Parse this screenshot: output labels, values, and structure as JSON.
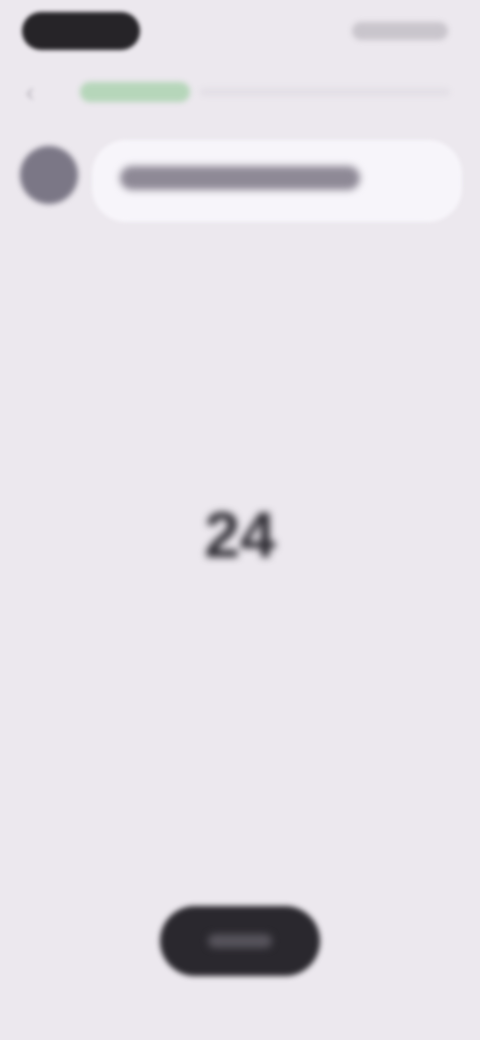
{
  "status_bar": {
    "time": "",
    "icons": [
      "signal-icon",
      "wifi-icon",
      "battery-icon"
    ]
  },
  "header": {
    "back_icon": "chevron-left-icon",
    "step_label": "",
    "progress": 0.2,
    "accent_color": "#b6d6ba"
  },
  "question": {
    "text": ""
  },
  "picker": {
    "options": [
      "",
      "",
      "24",
      "",
      ""
    ],
    "selected_index": 2
  },
  "footer": {
    "continue_label": ""
  },
  "colors": {
    "background": "#ece8ee",
    "button": "#2a282e",
    "bubble": "#f7f5fa"
  }
}
